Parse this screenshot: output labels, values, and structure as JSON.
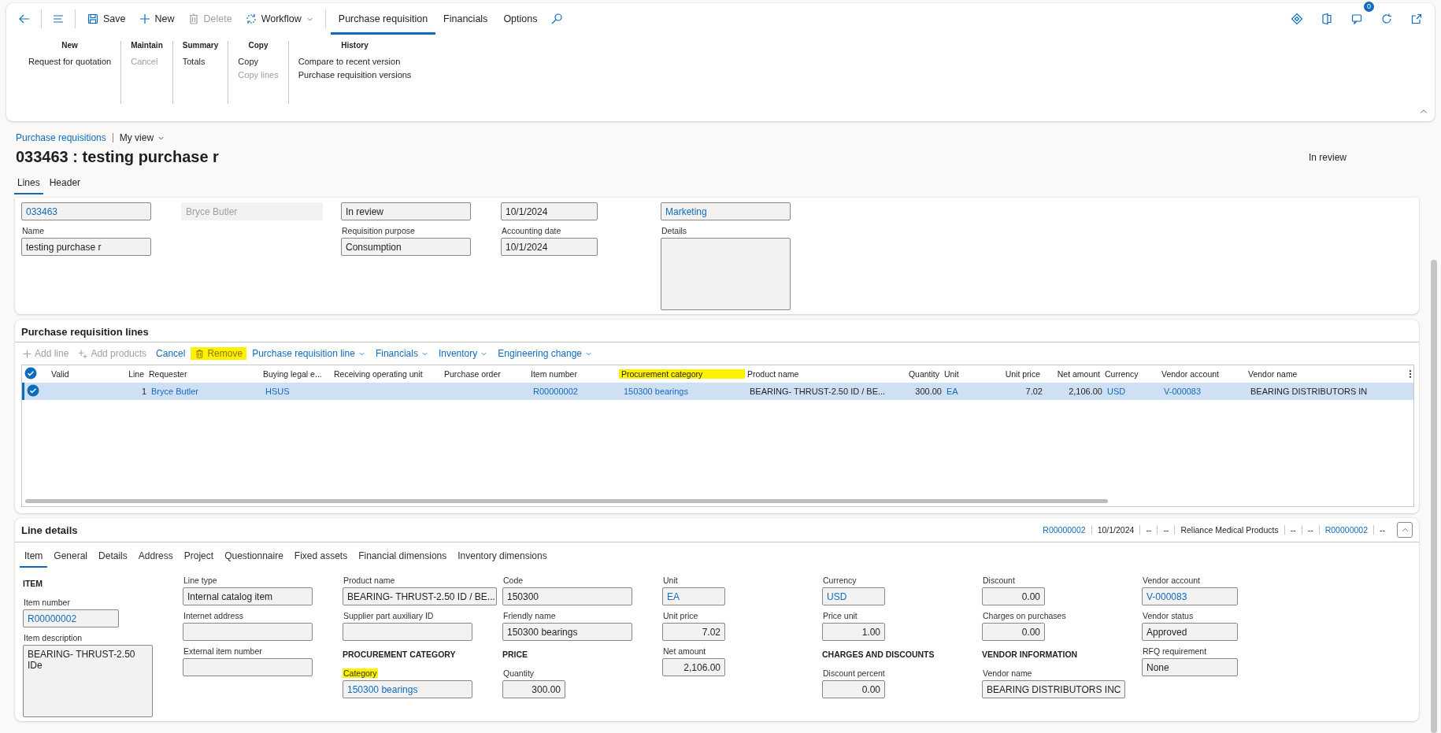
{
  "action_pane": {
    "commands": [
      {
        "label": "Save",
        "disabled": false,
        "kind": "button"
      },
      {
        "label": "New",
        "disabled": false,
        "kind": "button"
      },
      {
        "label": "Delete",
        "disabled": true,
        "kind": "button"
      },
      {
        "label": "Workflow",
        "disabled": false,
        "kind": "menu"
      }
    ],
    "tabs": [
      {
        "label": "Purchase requisition",
        "selected": true
      },
      {
        "label": "Financials",
        "selected": false
      },
      {
        "label": "Options",
        "selected": false
      }
    ],
    "notification_count": "0",
    "groups": [
      {
        "title": "New",
        "items": [
          {
            "label": "Request for quotation",
            "disabled": false
          }
        ]
      },
      {
        "title": "Maintain",
        "items": [
          {
            "label": "Cancel",
            "disabled": true
          }
        ]
      },
      {
        "title": "Summary",
        "items": [
          {
            "label": "Totals",
            "disabled": false
          }
        ]
      },
      {
        "title": "Copy",
        "items": [
          {
            "label": "Copy",
            "disabled": false
          },
          {
            "label": "Copy lines",
            "disabled": true
          }
        ]
      },
      {
        "title": "History",
        "items": [
          {
            "label": "Compare to recent version",
            "disabled": false
          },
          {
            "label": "Purchase requisition versions",
            "disabled": false
          }
        ]
      }
    ]
  },
  "breadcrumb": {
    "link": "Purchase requisitions",
    "view": "My view"
  },
  "title": "033463 : testing purchase r",
  "status": "In review",
  "page_tabs": [
    {
      "label": "Lines",
      "selected": true
    },
    {
      "label": "Header",
      "selected": false
    }
  ],
  "header_form": [
    [
      {
        "kind": "link",
        "value": "033463"
      },
      {
        "kind": "text",
        "label": "Name",
        "value": "testing purchase r"
      }
    ],
    [
      {
        "kind": "readonly",
        "value": "Bryce Butler"
      }
    ],
    [
      {
        "kind": "text",
        "value": "In review"
      },
      {
        "kind": "text",
        "label": "Requisition purpose",
        "value": "Consumption"
      }
    ],
    [
      {
        "kind": "text",
        "value": "10/1/2024"
      },
      {
        "kind": "text",
        "label": "Accounting date",
        "value": "10/1/2024"
      }
    ],
    [
      {
        "kind": "link",
        "value": "Marketing"
      },
      {
        "kind": "textarea",
        "label": "Details"
      }
    ]
  ],
  "lines": {
    "title": "Purchase requisition lines",
    "all_selected": true,
    "toolbar": [
      {
        "label": "Add line",
        "kind": "button",
        "disabled": true,
        "highlighted": false
      },
      {
        "label": "Add products",
        "kind": "button",
        "disabled": true,
        "highlighted": false
      },
      {
        "label": "Cancel",
        "kind": "button",
        "disabled": false,
        "highlighted": false
      },
      {
        "label": "Remove",
        "kind": "button",
        "disabled": false,
        "highlighted": true
      },
      {
        "label": "Purchase requisition line",
        "kind": "menu",
        "disabled": false,
        "highlighted": false
      },
      {
        "label": "Financials",
        "kind": "menu",
        "disabled": false,
        "highlighted": false
      },
      {
        "label": "Inventory",
        "kind": "menu",
        "disabled": false,
        "highlighted": false
      },
      {
        "label": "Engineering change",
        "kind": "menu",
        "disabled": false,
        "highlighted": false
      }
    ],
    "columns": [
      {
        "label": "Valid",
        "numeric": false,
        "highlighted": false
      },
      {
        "label": "Line",
        "numeric": true,
        "highlighted": false
      },
      {
        "label": "Requester",
        "numeric": false,
        "highlighted": false
      },
      {
        "label": "Buying legal e...",
        "numeric": false,
        "highlighted": false
      },
      {
        "label": "Receiving operating unit",
        "numeric": false,
        "highlighted": false
      },
      {
        "label": "Purchase order",
        "numeric": false,
        "highlighted": false
      },
      {
        "label": "Item number",
        "numeric": false,
        "highlighted": false
      },
      {
        "label": "Procurement category",
        "numeric": false,
        "highlighted": true
      },
      {
        "label": "Product name",
        "numeric": false,
        "highlighted": false
      },
      {
        "label": "Quantity",
        "numeric": true,
        "highlighted": false
      },
      {
        "label": "Unit",
        "numeric": false,
        "highlighted": false
      },
      {
        "label": "Unit price",
        "numeric": true,
        "highlighted": false
      },
      {
        "label": "Net amount",
        "numeric": true,
        "highlighted": false
      },
      {
        "label": "Currency",
        "numeric": false,
        "highlighted": false
      },
      {
        "label": "Vendor account",
        "numeric": false,
        "highlighted": false
      },
      {
        "label": "Vendor name",
        "numeric": false,
        "highlighted": false
      }
    ],
    "rows": [
      {
        "selected": true,
        "checked": true,
        "cells": [
          null,
          {
            "text": "1",
            "link": false
          },
          {
            "text": "Bryce Butler",
            "link": true
          },
          {
            "text": "HSUS",
            "link": true
          },
          null,
          null,
          {
            "text": "R00000002",
            "link": true
          },
          {
            "text": "150300 bearings",
            "link": true
          },
          {
            "text": "BEARING- THRUST-2.50 ID / BE...",
            "link": false
          },
          {
            "text": "300.00",
            "link": false
          },
          {
            "text": "EA",
            "link": true
          },
          {
            "text": "7.02",
            "link": false
          },
          {
            "text": "2,106.00",
            "link": false
          },
          {
            "text": "USD",
            "link": true
          },
          {
            "text": "V-000083",
            "link": true
          },
          {
            "text": "BEARING DISTRIBUTORS IN",
            "link": false
          }
        ]
      }
    ]
  },
  "line_details": {
    "title": "Line details",
    "summary": [
      {
        "text": "R00000002",
        "link": true
      },
      {
        "text": "10/1/2024",
        "link": false
      },
      {
        "text": "--",
        "link": false
      },
      {
        "text": "--",
        "link": false
      },
      {
        "text": "Reliance Medical Products",
        "link": false
      },
      {
        "text": "--",
        "link": false
      },
      {
        "text": "--",
        "link": false
      },
      {
        "text": "R00000002",
        "link": true
      },
      {
        "text": "--",
        "link": false
      }
    ],
    "tabs": [
      {
        "label": "Item",
        "selected": true
      },
      {
        "label": "General",
        "selected": false
      },
      {
        "label": "Details",
        "selected": false
      },
      {
        "label": "Address",
        "selected": false
      },
      {
        "label": "Project",
        "selected": false
      },
      {
        "label": "Questionnaire",
        "selected": false
      },
      {
        "label": "Fixed assets",
        "selected": false
      },
      {
        "label": "Financial dimensions",
        "selected": false
      },
      {
        "label": "Inventory dimensions",
        "selected": false
      }
    ],
    "columns": [
      [
        {
          "kind": "heading",
          "label": "ITEM"
        },
        {
          "kind": "link",
          "label": "Item number",
          "value": "R00000002",
          "highlighted": false
        },
        {
          "kind": "textarea",
          "label": "Item description",
          "value": "BEARING- THRUST-2.50 IDe",
          "highlighted": false
        }
      ],
      [
        {
          "kind": "text",
          "label": "Line type",
          "value": "Internal catalog item",
          "highlighted": false
        },
        {
          "kind": "text",
          "label": "Internet address",
          "highlighted": false
        },
        {
          "kind": "text",
          "label": "External item number",
          "highlighted": false
        }
      ],
      [
        {
          "kind": "text",
          "label": "Product name",
          "value": "BEARING- THRUST-2.50 ID / BE...",
          "highlighted": false
        },
        {
          "kind": "text",
          "label": "Supplier part auxiliary ID",
          "highlighted": false
        },
        {
          "kind": "heading",
          "label": "PROCUREMENT CATEGORY"
        },
        {
          "kind": "link",
          "label": "Category",
          "value": "150300 bearings",
          "highlighted": true
        }
      ],
      [
        {
          "kind": "text",
          "label": "Code",
          "value": "150300",
          "highlighted": false
        },
        {
          "kind": "text",
          "label": "Friendly name",
          "value": "150300 bearings",
          "highlighted": false
        },
        {
          "kind": "heading",
          "label": "PRICE"
        },
        {
          "kind": "number",
          "label": "Quantity",
          "value": "300.00",
          "highlighted": false
        }
      ],
      [
        {
          "kind": "link",
          "label": "Unit",
          "value": "EA",
          "highlighted": false
        },
        {
          "kind": "number",
          "label": "Unit price",
          "value": "7.02",
          "highlighted": false
        },
        {
          "kind": "number",
          "label": "Net amount",
          "value": "2,106.00",
          "highlighted": false
        }
      ],
      [
        {
          "kind": "link",
          "label": "Currency",
          "value": "USD",
          "highlighted": false
        },
        {
          "kind": "number",
          "label": "Price unit",
          "value": "1.00",
          "highlighted": false
        },
        {
          "kind": "heading",
          "label": "CHARGES AND DISCOUNTS"
        },
        {
          "kind": "number",
          "label": "Discount percent",
          "value": "0.00",
          "highlighted": false
        }
      ],
      [
        {
          "kind": "number",
          "label": "Discount",
          "value": "0.00",
          "highlighted": false
        },
        {
          "kind": "number",
          "label": "Charges on purchases",
          "value": "0.00",
          "highlighted": false
        },
        {
          "kind": "heading",
          "label": "VENDOR INFORMATION"
        },
        {
          "kind": "text",
          "label": "Vendor name",
          "value": "BEARING DISTRIBUTORS INC",
          "highlighted": false
        }
      ],
      [
        {
          "kind": "link",
          "label": "Vendor account",
          "value": "V-000083",
          "highlighted": false
        },
        {
          "kind": "text",
          "label": "Vendor status",
          "value": "Approved",
          "highlighted": false
        },
        {
          "kind": "text",
          "label": "RFQ requirement",
          "value": "None",
          "highlighted": false
        }
      ]
    ]
  }
}
